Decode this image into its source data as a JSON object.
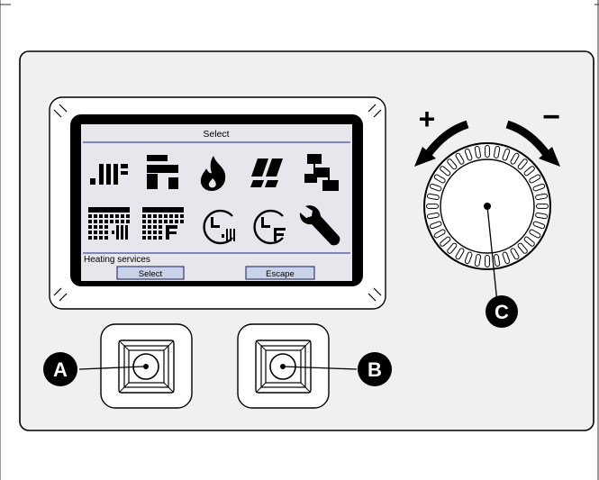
{
  "screen": {
    "title": "Select",
    "status": "Heating services",
    "softkeys": [
      "Select",
      "Escape"
    ],
    "icons": [
      "heating-circuits-icon",
      "hot-water-icon",
      "flame-icon",
      "solar-icon",
      "network-icon",
      "heating-program-icon",
      "hot-water-program-icon",
      "heating-clock-icon",
      "hot-water-clock-icon",
      "wrench-icon"
    ]
  },
  "dial": {
    "plus": "+",
    "minus": "−"
  },
  "callouts": {
    "a": "A",
    "b": "B",
    "c": "C"
  },
  "colors": {
    "screen_bg": "#e6e6ec",
    "divider_blue": "#3c4c9c",
    "softkey_fill": "#c8d2e8",
    "ink": "#000000"
  }
}
